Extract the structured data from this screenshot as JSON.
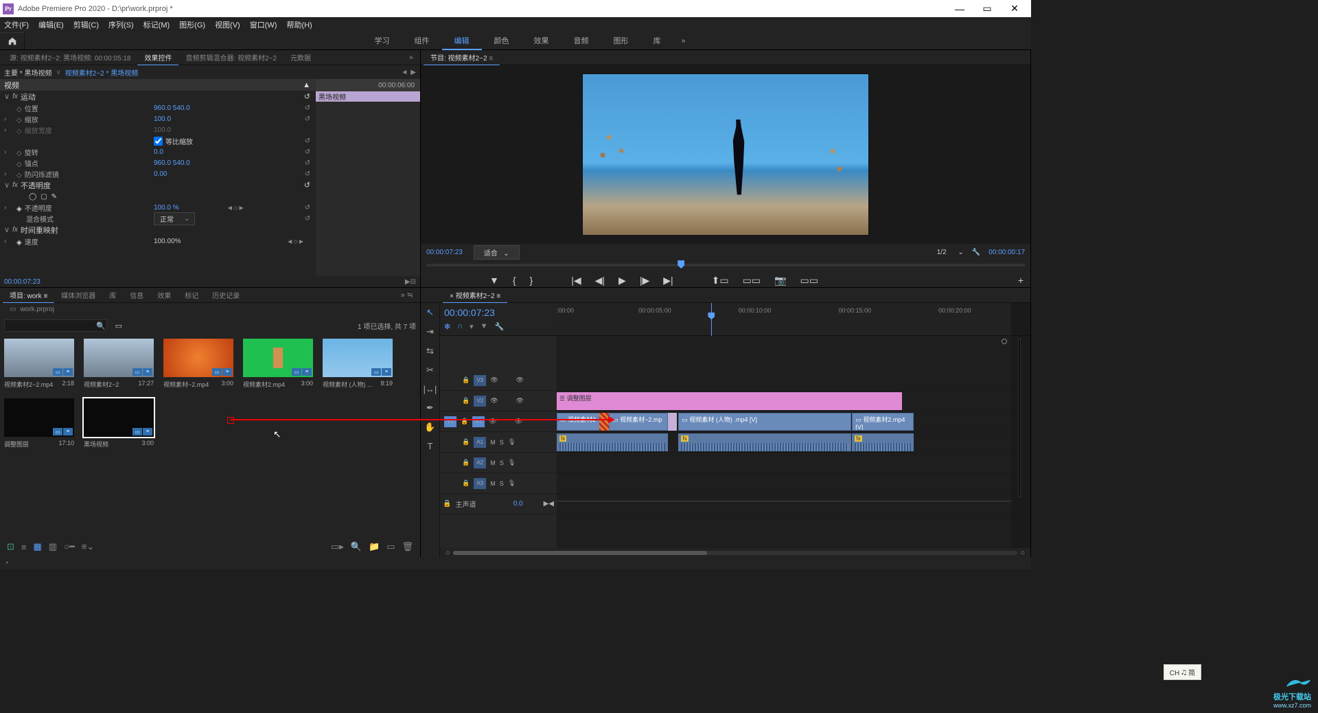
{
  "titlebar": {
    "app_icon": "Pr",
    "title": "Adobe Premiere Pro 2020 - D:\\pr\\work.prproj *"
  },
  "menubar": [
    "文件(F)",
    "编辑(E)",
    "剪辑(C)",
    "序列(S)",
    "标记(M)",
    "图形(G)",
    "视图(V)",
    "窗口(W)",
    "帮助(H)"
  ],
  "workspace_tabs": [
    "学习",
    "组件",
    "编辑",
    "颜色",
    "效果",
    "音频",
    "图形",
    "库"
  ],
  "workspace_active": "编辑",
  "source_tabs": {
    "source": "源: 视频素材2~2: 黑场视频: 00:00:05:18",
    "effect_controls": "效果控件",
    "audio_mixer": "音频剪辑混合器: 视频素材2~2",
    "metadata": "元数据"
  },
  "ec": {
    "master_label": "主要 * 黑场视频",
    "sequence_label": "视频素材2~2 * 黑场视频",
    "tc_end": "00:00:06:00",
    "clip_name": "黑场视频",
    "section_video": "视频",
    "fx_motion": "运动",
    "prop_position": "位置",
    "val_position": "960.0    540.0",
    "prop_scale": "缩放",
    "val_scale": "100.0",
    "prop_scalew": "缩放宽度",
    "val_scalew": "100.0",
    "uniform_scale": "等比缩放",
    "prop_rotation": "旋转",
    "val_rotation": "0.0",
    "prop_anchor": "锚点",
    "val_anchor": "960.0    540.0",
    "prop_antiflicker": "防闪烁滤镜",
    "val_antiflicker": "0.00",
    "fx_opacity": "不透明度",
    "prop_opacity": "不透明度",
    "val_opacity": "100.0 %",
    "prop_blend": "混合模式",
    "val_blend": "正常",
    "fx_timeremap": "时间重映射",
    "prop_speed": "速度",
    "val_speed": "100.00%",
    "bottom_tc": "00:00:07:23"
  },
  "program": {
    "tab": "节目: 视频素材2~2",
    "tc": "00:00:07:23",
    "fit": "适合",
    "zoom": "1/2",
    "duration": "00:00:00:17"
  },
  "project": {
    "tabs": [
      "项目: work",
      "媒体浏览器",
      "库",
      "信息",
      "效果",
      "标记",
      "历史记录"
    ],
    "filename": "work.prproj",
    "search_placeholder": "",
    "status": "1 项已选择, 共 7 项",
    "thumbs": [
      {
        "name": "视频素材2~2.mp4",
        "dur": "2:18",
        "cls": "city"
      },
      {
        "name": "视频素材2~2",
        "dur": "17:27",
        "cls": "city"
      },
      {
        "name": "视频素材~2.mp4",
        "dur": "3:00",
        "cls": "leaves"
      },
      {
        "name": "视频素材2.mp4",
        "dur": "3:00",
        "cls": "green"
      },
      {
        "name": "视频素材 (人物) ...",
        "dur": "8:19",
        "cls": "person"
      },
      {
        "name": "调整图层",
        "dur": "17:10",
        "cls": "black"
      },
      {
        "name": "黑场视频",
        "dur": "3:00",
        "cls": "black",
        "selected": true
      }
    ]
  },
  "timeline": {
    "tab": "视频素材2~2",
    "tc": "00:00:07:23",
    "ticks": [
      {
        "label": ":00:00",
        "pos": 0
      },
      {
        "label": "00:00:05:00",
        "pos": 18
      },
      {
        "label": "00:00:10:00",
        "pos": 40
      },
      {
        "label": "00:00:15:00",
        "pos": 62
      },
      {
        "label": "00:00:20:00",
        "pos": 84
      }
    ],
    "master_db": "0.0",
    "tracks_v": [
      "V3",
      "V2",
      "V1"
    ],
    "tracks_a": [
      "A1",
      "A2",
      "A3"
    ],
    "master": "主声道",
    "clips": {
      "adjust": "调整图层",
      "vc1": "视频素材2~",
      "vc2": "视频素材~2.mp",
      "vc3": "视频素材 (人物) .mp4 [V]",
      "vc4": "视频素材2.mp4 [V]"
    }
  },
  "tooltip": "CH 🎝 简",
  "watermark": "极光下载站\nwww.xz7.com"
}
